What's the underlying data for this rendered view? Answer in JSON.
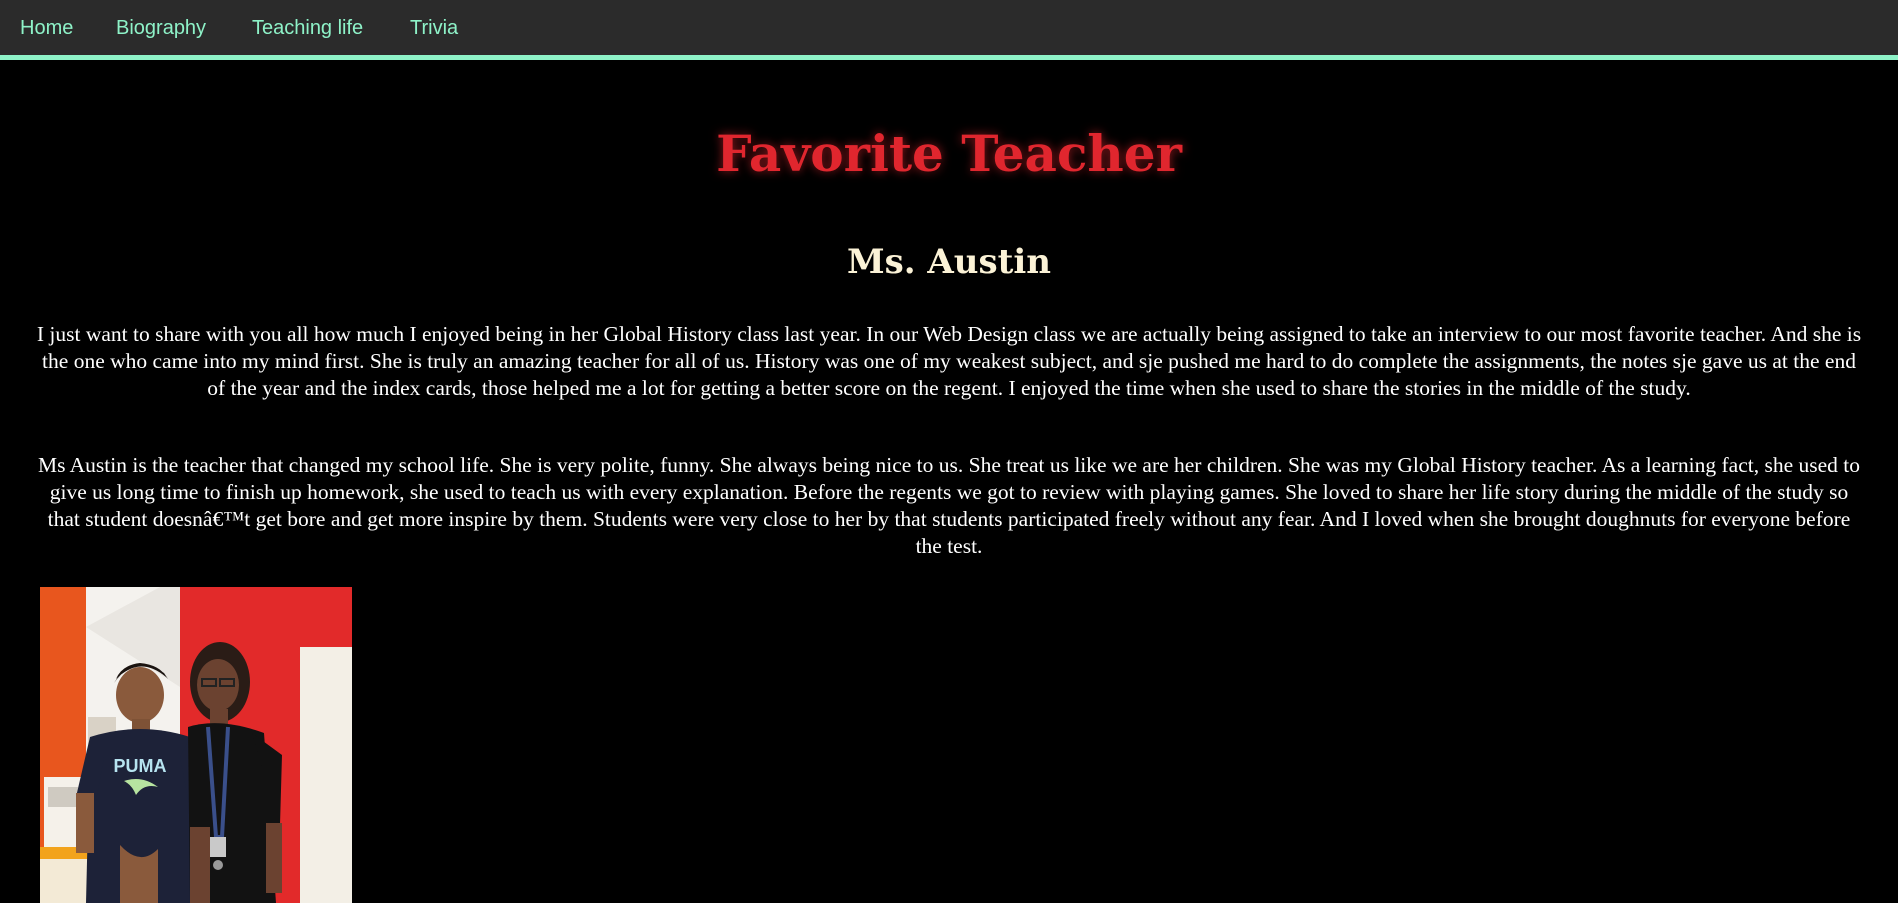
{
  "nav": {
    "items": [
      {
        "label": "Home"
      },
      {
        "label": "Biography"
      },
      {
        "label": "Teaching life"
      },
      {
        "label": "Trivia"
      }
    ]
  },
  "page": {
    "title": "Favorite Teacher",
    "subtitle": "Ms. Austin",
    "paragraphs": [
      "I just want to share with you all how much I enjoyed being in her Global History class last year. In our Web Design class we are actually being assigned to take an interview to our most favorite teacher. And she is the one who came into my mind first. She is truly an amazing teacher for all of us. History was one of my weakest subject, and sje pushed me hard to do complete the assignments, the notes sje gave us at the end of the year and the index cards, those helped me a lot for getting a better score on the regent. I enjoyed the time when she used to share the stories in the middle of the study.",
      "Ms Austin is the teacher that changed my school life. She is very polite, funny. She always being nice to us. She treat us like we are her children. She was my Global History teacher. As a learning fact, she used to give us long time to finish up homework, she used to teach us with every explanation. Before the regents we got to review with playing games. She loved to share her life story during the middle of the study so that student doesnâ€™t get bore and get more inspire by them. Students were very close to her by that students participated freely without any fear. And I loved when she brought doughnuts for everyone before the test."
    ],
    "photo": {
      "shirt_text": "PUMA"
    }
  },
  "colors": {
    "nav_bg": "#2b2b2b",
    "nav_accent": "#8ef2c8",
    "title": "#e0262e",
    "subtitle": "#fbf2d6",
    "body_text": "#ffffff",
    "page_bg": "#000000"
  }
}
